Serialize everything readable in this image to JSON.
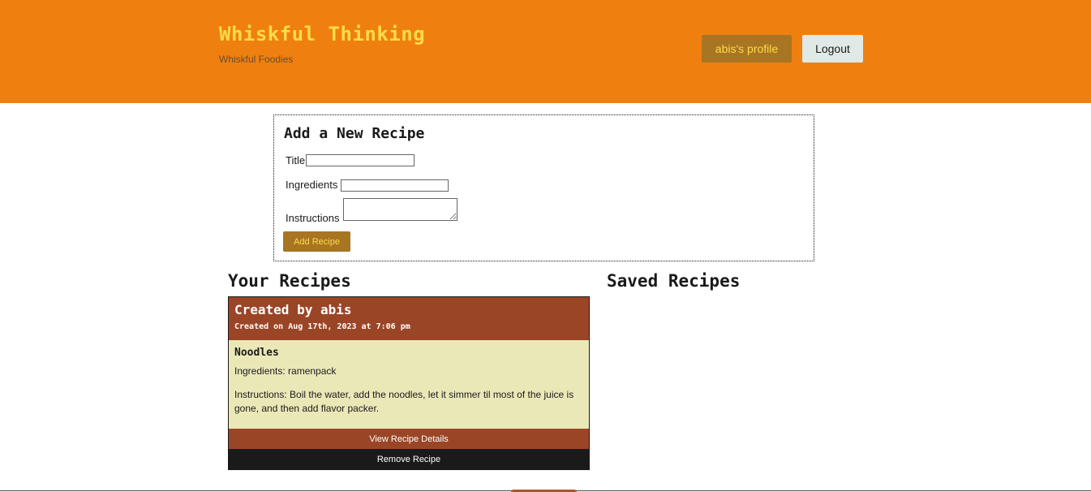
{
  "header": {
    "title": "Whiskful Thinking",
    "subtitle": "Whiskful Foodies",
    "profile_label": "abis's profile",
    "logout_label": "Logout"
  },
  "form": {
    "title": "Add a New Recipe",
    "title_label": "Title",
    "title_value": "",
    "ingredients_label": "Ingredients",
    "ingredients_value": "",
    "instructions_label": "Instructions",
    "instructions_value": "",
    "submit_label": "Add Recipe"
  },
  "your_recipes": {
    "heading": "Your Recipes",
    "cards": [
      {
        "author": "Created by abis",
        "date": "Created on Aug 17th, 2023 at 7:06 pm",
        "name": "Noodles",
        "ingredients": "Ingredients: ramenpack",
        "instructions": "Instructions: Boil the water, add the noodles, let it simmer til most of the juice is gone, and then add flavor packer.",
        "view_label": "View Recipe Details",
        "remove_label": "Remove Recipe"
      }
    ]
  },
  "saved_recipes": {
    "heading": "Saved Recipes"
  },
  "colors": {
    "header_bg": "#ef8010",
    "brand_yellow": "#fddc47",
    "accent_gold": "#a87523",
    "card_header": "#9b4527",
    "card_body": "#ebe8b8",
    "dark": "#1a1a1a"
  }
}
